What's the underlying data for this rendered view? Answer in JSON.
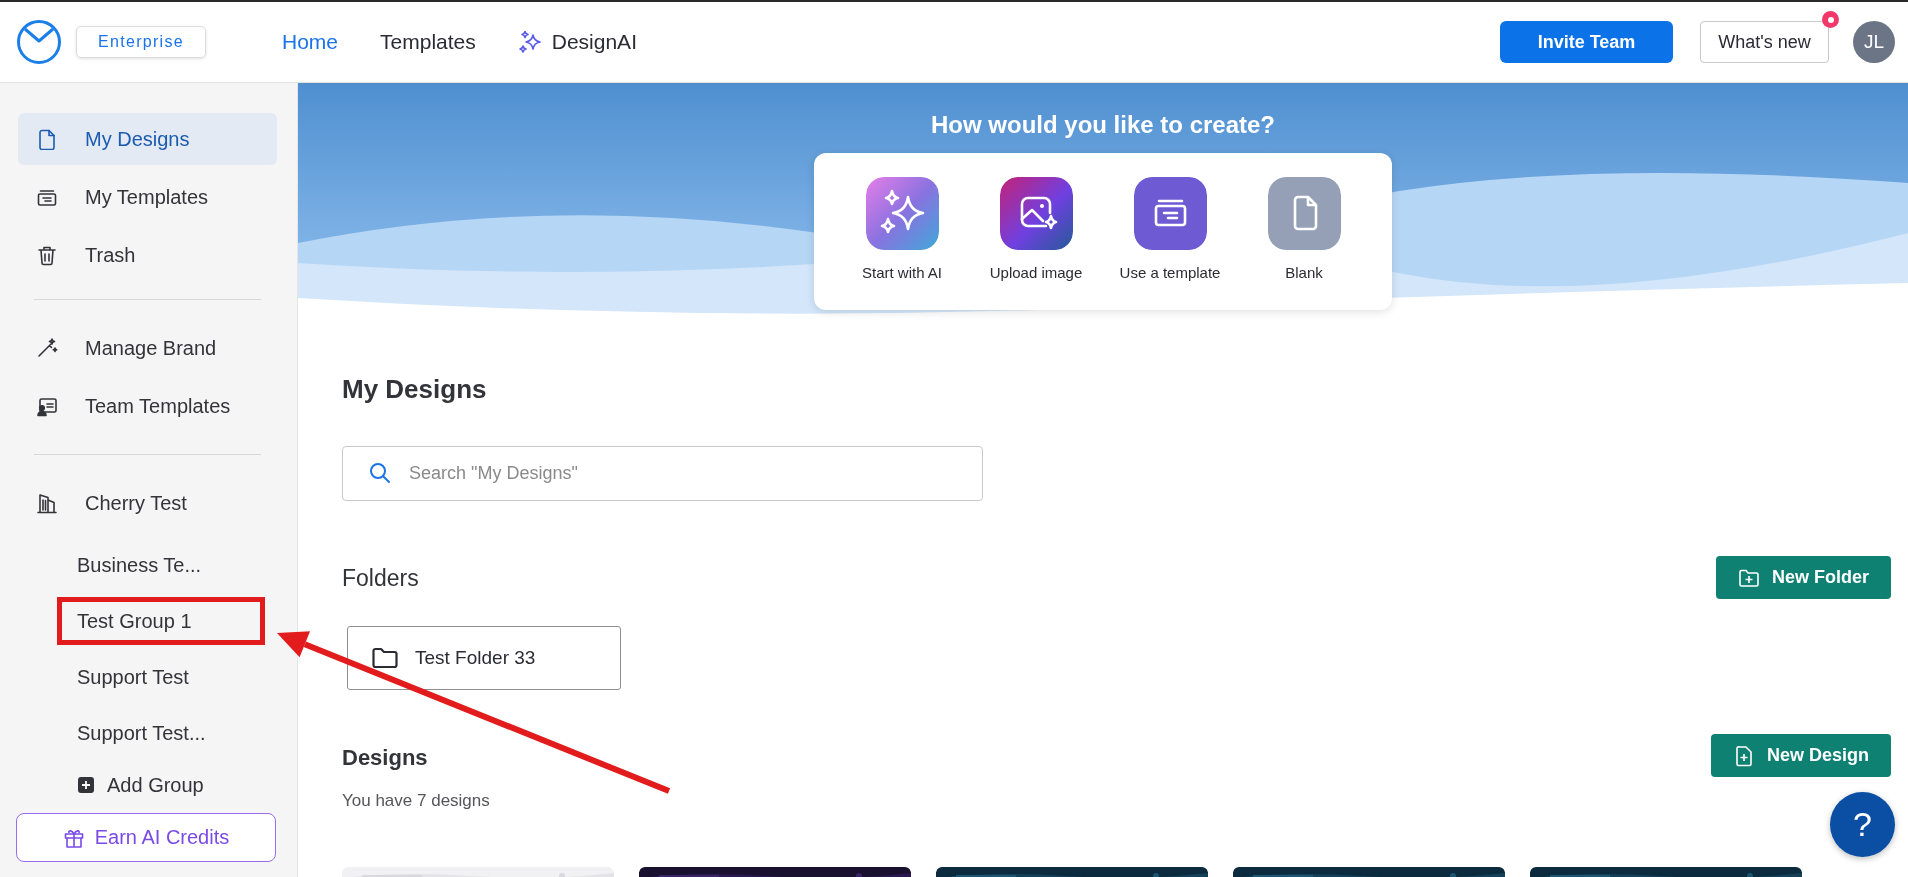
{
  "header": {
    "plan_badge": "Enterprise",
    "nav": [
      {
        "label": "Home",
        "selected": true
      },
      {
        "label": "Templates",
        "selected": false
      },
      {
        "label": "DesignAI",
        "selected": false,
        "kind": "ai"
      }
    ],
    "invite_button": "Invite Team",
    "whats_new": {
      "label": "What's new",
      "unread": true
    },
    "avatar": "JL"
  },
  "sidebar": {
    "sections": [
      {
        "items": [
          {
            "label": "My Designs",
            "selected": true
          },
          {
            "label": "My Templates",
            "selected": false
          },
          {
            "label": "Trash",
            "selected": false
          }
        ]
      },
      {
        "items": [
          {
            "label": "Manage Brand",
            "selected": false
          },
          {
            "label": "Team Templates",
            "selected": false
          }
        ]
      },
      {
        "items": [
          {
            "label": "Cherry Test",
            "selected": false,
            "children": [
              {
                "label": "Business Te...",
                "highlighted": false
              },
              {
                "label": "Test Group 1",
                "highlighted": true
              },
              {
                "label": "Support Test",
                "highlighted": false
              },
              {
                "label": "Support Test...",
                "highlighted": false
              },
              {
                "label": "Add Group",
                "kind": "add",
                "highlighted": false
              }
            ]
          }
        ]
      }
    ],
    "credits_button": "Earn AI Credits"
  },
  "create_prompt": {
    "title": "How would you like to create?",
    "options": [
      "Start with AI",
      "Upload image",
      "Use a template",
      "Blank"
    ]
  },
  "my_designs": {
    "title": "My Designs",
    "search": {
      "placeholder": "Search \"My Designs\""
    }
  },
  "folders": {
    "title": "Folders",
    "new_button": "New Folder",
    "items": [
      {
        "name": "Test Folder 33"
      }
    ]
  },
  "designs": {
    "title": "Designs",
    "new_button": "New Design",
    "count_text": "You have 7 designs"
  },
  "help_button": "?"
}
